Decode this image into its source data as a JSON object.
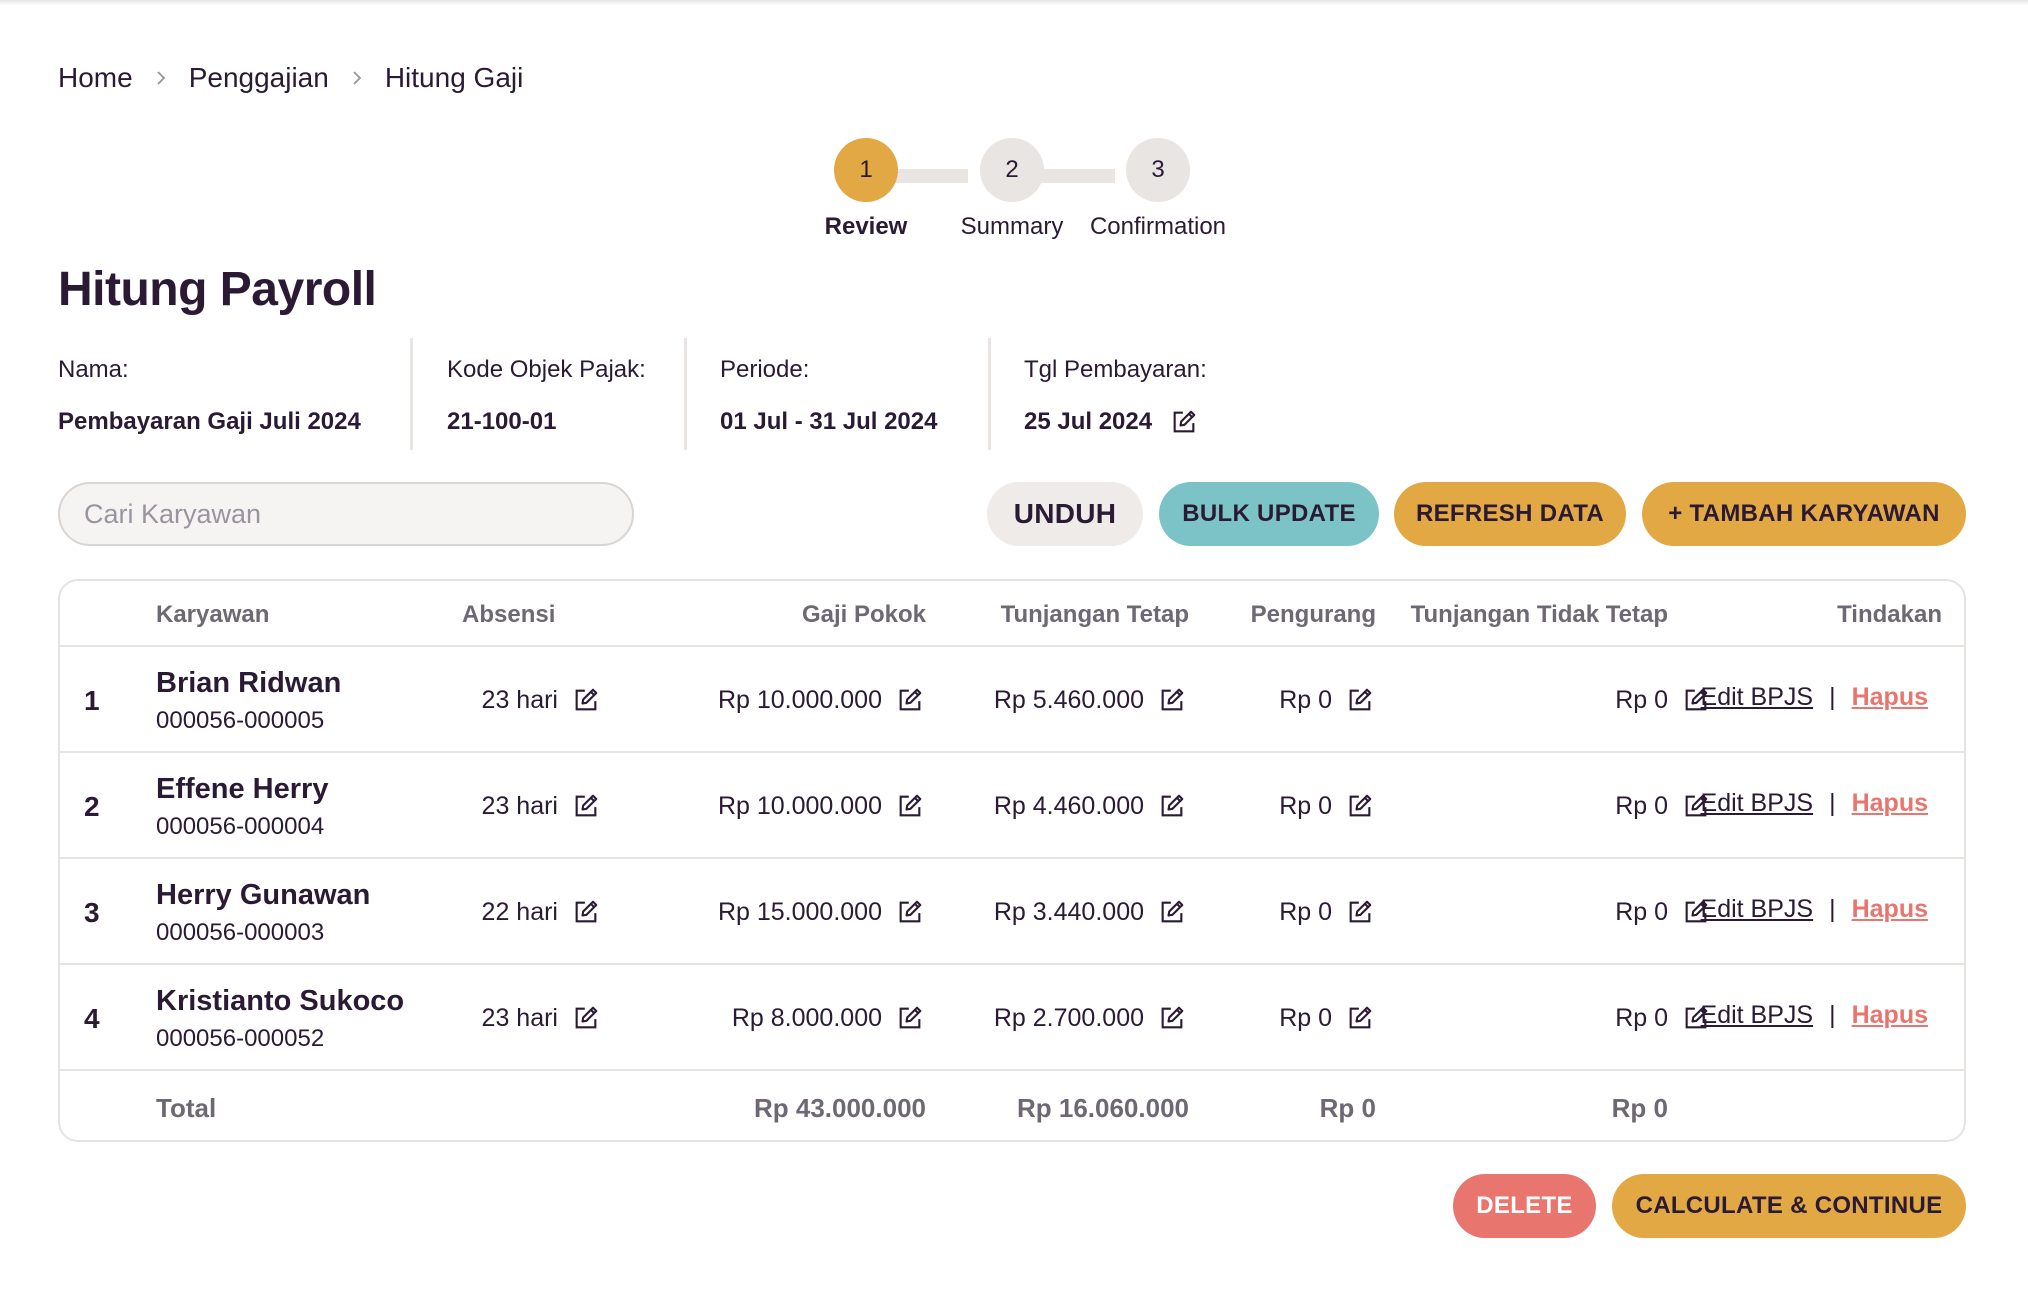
{
  "breadcrumb": {
    "home": "Home",
    "payroll": "Penggajian",
    "current": "Hitung Gaji"
  },
  "stepper": {
    "steps": [
      {
        "number": "1",
        "label": "Review",
        "active": true
      },
      {
        "number": "2",
        "label": "Summary",
        "active": false
      },
      {
        "number": "3",
        "label": "Confirmation",
        "active": false
      }
    ]
  },
  "page": {
    "title": "Hitung Payroll"
  },
  "info": {
    "name_label": "Nama:",
    "name_value": "Pembayaran Gaji Juli 2024",
    "tax_label": "Kode Objek Pajak:",
    "tax_value": "21-100-01",
    "period_label": "Periode:",
    "period_value": "01 Jul - 31 Jul 2024",
    "paydate_label": "Tgl Pembayaran:",
    "paydate_value": "25 Jul 2024"
  },
  "search": {
    "placeholder": "Cari Karyawan",
    "value": ""
  },
  "toolbar": {
    "unduh": "UNDUH",
    "bulk_update": "BULK UPDATE",
    "refresh": "REFRESH DATA",
    "add_employee": "+ TAMBAH KARYAWAN"
  },
  "table": {
    "headers": {
      "employee": "Karyawan",
      "attendance": "Absensi",
      "base_salary": "Gaji Pokok",
      "fixed_allowance": "Tunjangan Tetap",
      "deduction": "Pengurang",
      "variable_allowance": "Tunjangan Tidak Tetap",
      "actions": "Tindakan"
    },
    "rows": [
      {
        "no": "1",
        "name": "Brian Ridwan",
        "id": "000056-000005",
        "attendance": "23 hari",
        "base_salary": "Rp 10.000.000",
        "fixed_allowance": "Rp 5.460.000",
        "deduction": "Rp 0",
        "variable_allowance": "Rp 0",
        "edit_bpjs": "Edit BPJS",
        "delete": "Hapus"
      },
      {
        "no": "2",
        "name": "Effene Herry",
        "id": "000056-000004",
        "attendance": "23 hari",
        "base_salary": "Rp 10.000.000",
        "fixed_allowance": "Rp 4.460.000",
        "deduction": "Rp 0",
        "variable_allowance": "Rp 0",
        "edit_bpjs": "Edit BPJS",
        "delete": "Hapus"
      },
      {
        "no": "3",
        "name": "Herry Gunawan",
        "id": "000056-000003",
        "attendance": "22 hari",
        "base_salary": "Rp 15.000.000",
        "fixed_allowance": "Rp 3.440.000",
        "deduction": "Rp 0",
        "variable_allowance": "Rp 0",
        "edit_bpjs": "Edit BPJS",
        "delete": "Hapus"
      },
      {
        "no": "4",
        "name": "Kristianto Sukoco",
        "id": "000056-000052",
        "attendance": "23 hari",
        "base_salary": "Rp 8.000.000",
        "fixed_allowance": "Rp 2.700.000",
        "deduction": "Rp 0",
        "variable_allowance": "Rp 0",
        "edit_bpjs": "Edit BPJS",
        "delete": "Hapus"
      }
    ],
    "total": {
      "label": "Total",
      "base_salary": "Rp 43.000.000",
      "fixed_allowance": "Rp 16.060.000",
      "deduction": "Rp 0",
      "variable_allowance": "Rp 0"
    }
  },
  "footer": {
    "delete": "DELETE",
    "calculate": "CALCULATE & CONTINUE"
  },
  "colors": {
    "accent": "#e2a844",
    "teal": "#7cc3c8",
    "danger": "#e8756e",
    "text": "#2b1a33"
  },
  "icons": {
    "edit": "edit-icon",
    "chevron": "chevron-right-icon"
  }
}
